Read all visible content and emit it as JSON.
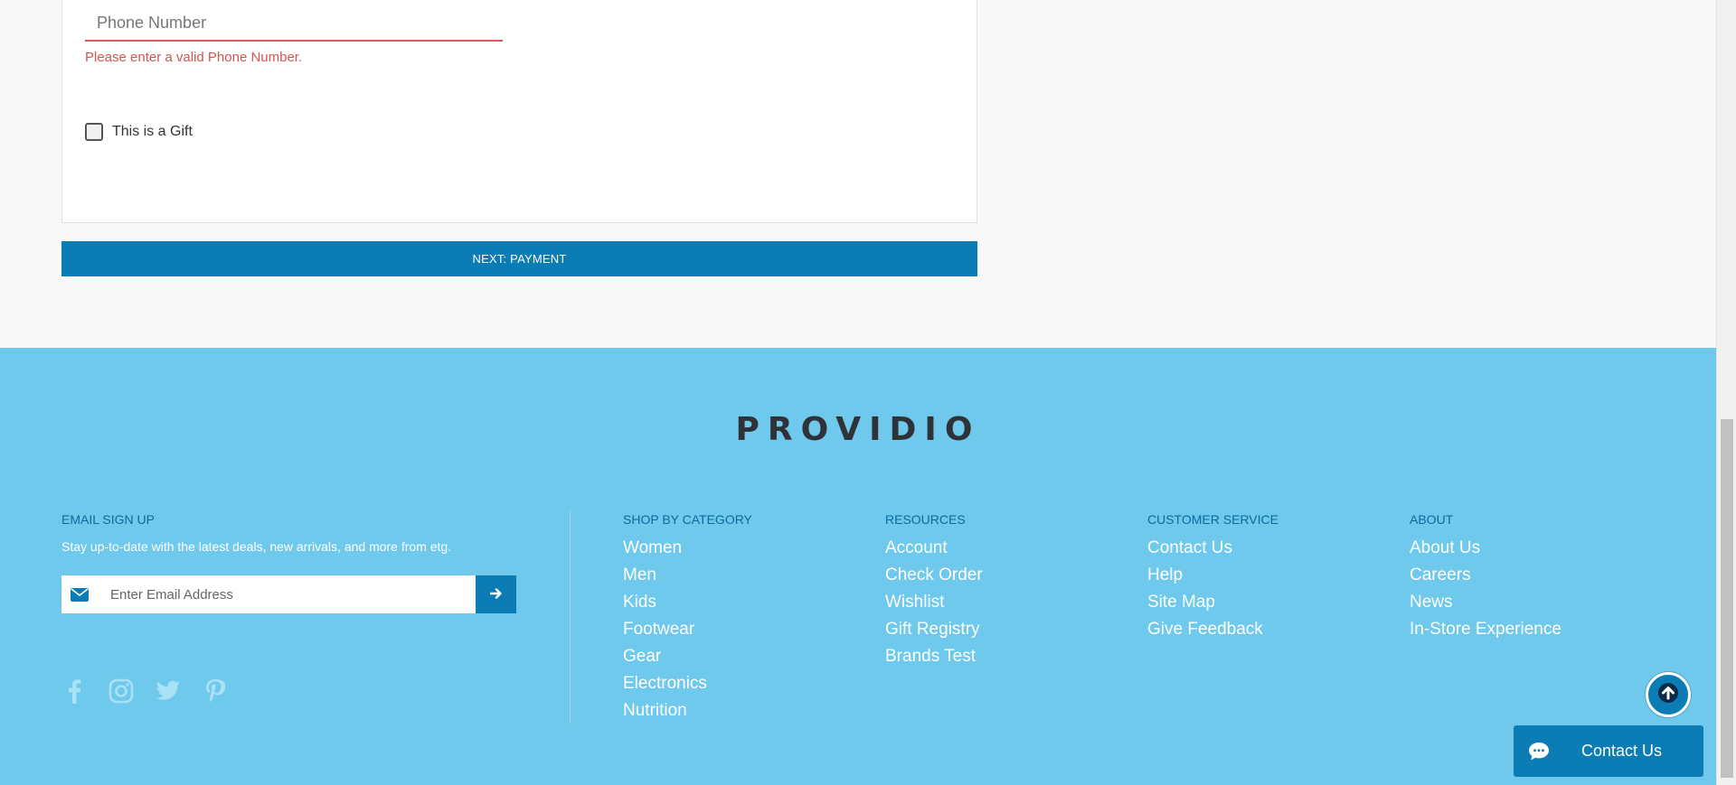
{
  "checkout": {
    "phone_placeholder": "Phone Number",
    "phone_error": "Please enter a valid Phone Number.",
    "gift_label": "This is a Gift",
    "gift_checked": false,
    "next_button": "NEXT: PAYMENT"
  },
  "footer": {
    "brand": "PROVIDIO",
    "signup": {
      "heading": "EMAIL SIGN UP",
      "text": "Stay up-to-date with the latest deals, new arrivals, and more from etg.",
      "email_placeholder": "Enter Email Address",
      "email_icon": "envelope-icon",
      "submit_icon": "arrow-right-icon"
    },
    "socials": [
      "facebook-icon",
      "instagram-icon",
      "twitter-icon",
      "pinterest-icon"
    ],
    "columns": [
      {
        "heading": "SHOP BY CATEGORY",
        "links": [
          "Women",
          "Men",
          "Kids",
          "Footwear",
          "Gear",
          "Electronics",
          "Nutrition"
        ]
      },
      {
        "heading": "RESOURCES",
        "links": [
          "Account",
          "Check Order",
          "Wishlist",
          "Gift Registry",
          "Brands Test"
        ]
      },
      {
        "heading": "CUSTOMER SERVICE",
        "links": [
          "Contact Us",
          "Help",
          "Site Map",
          "Give Feedback"
        ]
      },
      {
        "heading": "ABOUT",
        "links": [
          "About Us",
          "Careers",
          "News",
          "In-Store Experience"
        ]
      }
    ]
  },
  "chat": {
    "label": "Contact Us",
    "icon": "chat-bubble-icon"
  },
  "scroll_top_icon": "arrow-up-icon",
  "colors": {
    "primary": "#0b7db4",
    "footer_bg": "#6ec9ec",
    "error": "#d9534f",
    "heading": "#0b6a9c"
  }
}
